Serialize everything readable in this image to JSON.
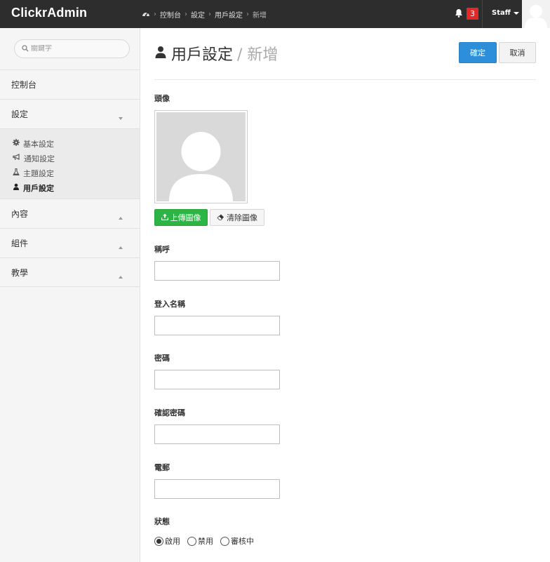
{
  "app": {
    "brand": "ClickrAdmin"
  },
  "breadcrumb": {
    "items": [
      "控制台",
      "設定",
      "用戶設定"
    ],
    "current": "新增"
  },
  "topbar": {
    "notification_count": "3",
    "user_label": "Staff"
  },
  "sidebar": {
    "search_placeholder": "關鍵字",
    "nav": [
      {
        "label": "控制台"
      },
      {
        "label": "設定"
      },
      {
        "label": "內容"
      },
      {
        "label": "組件"
      },
      {
        "label": "教學"
      }
    ],
    "settings_sub": [
      {
        "label": "基本設定",
        "icon": "gear-icon"
      },
      {
        "label": "通知設定",
        "icon": "bullhorn-icon"
      },
      {
        "label": "主題設定",
        "icon": "flask-icon"
      },
      {
        "label": "用戶設定",
        "icon": "user-icon",
        "active": true
      }
    ]
  },
  "page": {
    "title": "用戶設定",
    "subtitle": "/ 新增",
    "ok_label": "確定",
    "cancel_label": "取消"
  },
  "form": {
    "avatar_label": "頭像",
    "upload_label": "上傳圖像",
    "clear_label": "清除圖像",
    "nickname_label": "稱呼",
    "nickname_value": "",
    "username_label": "登入名稱",
    "username_value": "",
    "password_label": "密碼",
    "password_value": "",
    "confirm_label": "確認密碼",
    "confirm_value": "",
    "email_label": "電郵",
    "email_value": "",
    "status_label": "狀態",
    "status_options": [
      "啟用",
      "禁用",
      "審核中"
    ],
    "status_selected": "啟用"
  },
  "colors": {
    "topbar": "#2d2d2d",
    "primary": "#2d8fd9",
    "success": "#2cb544",
    "badge": "#e02a2a"
  }
}
